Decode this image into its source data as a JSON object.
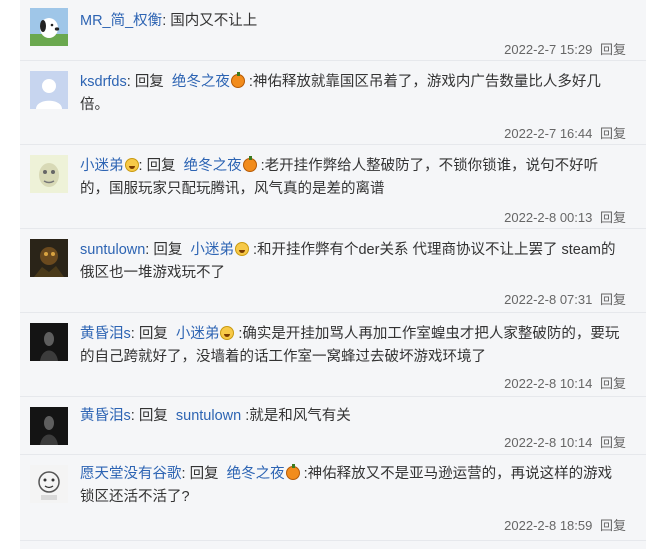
{
  "reply_label": "回复",
  "comments": [
    {
      "user": "MR_简_权衡",
      "is_reply": false,
      "target": "",
      "target_emoji": "",
      "text": "国内又不让上",
      "time": "2022-2-7 15:29",
      "action": "回复",
      "avatar": "snoopy-avatar"
    },
    {
      "user": "ksdrfds",
      "is_reply": true,
      "target": "绝冬之夜",
      "target_emoji": "pumpkin",
      "text": ":神佑释放就靠国区吊着了，游戏内广告数量比人多好几倍。",
      "time": "2022-2-7 16:44",
      "action": "回复",
      "avatar": "default-avatar"
    },
    {
      "user": "小迷弟",
      "user_emoji": "laugh",
      "is_reply": true,
      "target": "绝冬之夜",
      "target_emoji": "pumpkin",
      "text": ":老开挂作弊给人整破防了，不锁你锁谁，说句不好听的，国服玩家只配玩腾讯，风气真的是差的离谱",
      "time": "2022-2-8 00:13",
      "action": "回复",
      "avatar": "cartoon-avatar"
    },
    {
      "user": "suntulown",
      "is_reply": true,
      "target": "小迷弟",
      "target_emoji": "laugh",
      "text": ":和开挂作弊有个der关系 代理商协议不让上罢了 steam的俄区也一堆游戏玩不了",
      "time": "2022-2-8 07:31",
      "action": "回复",
      "avatar": "dark-art-avatar"
    },
    {
      "user": "黄昏泪s",
      "is_reply": true,
      "target": "小迷弟",
      "target_emoji": "laugh",
      "text": ":确实是开挂加骂人再加工作室蝗虫才把人家整破防的，要玩的自己跨就好了，没墙着的话工作室一窝蜂过去破坏游戏环境了",
      "time": "2022-2-8 10:14",
      "action": "回复",
      "avatar": "dark-figure-avatar"
    },
    {
      "user": "黄昏泪s",
      "is_reply": true,
      "target": "suntulown",
      "target_emoji": "",
      "text": ":就是和风气有关",
      "time": "2022-2-8 10:14",
      "action": "回复",
      "avatar": "dark-figure-avatar"
    },
    {
      "user": "愿天堂没有谷歌",
      "is_reply": true,
      "target": "绝冬之夜",
      "target_emoji": "pumpkin",
      "text": ":神佑释放又不是亚马逊运营的，再说这样的游戏锁区还活不活了?",
      "time": "2022-2-8 18:59",
      "action": "回复",
      "avatar": "sketch-avatar"
    }
  ]
}
